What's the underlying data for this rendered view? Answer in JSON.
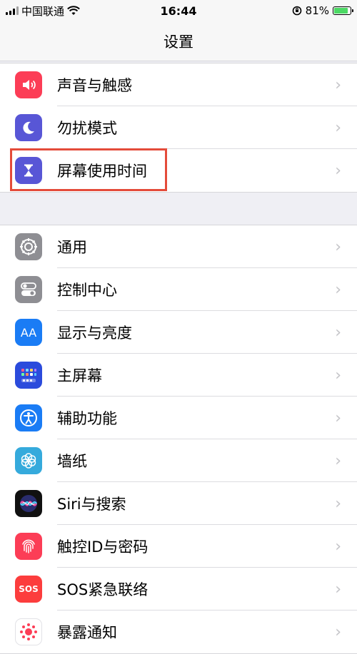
{
  "status_bar": {
    "carrier": "中国联通",
    "time": "16:44",
    "battery_percent": "81%",
    "battery_level": 0.81
  },
  "nav": {
    "title": "设置"
  },
  "group1": [
    {
      "label": "声音与触感",
      "icon": "speaker-icon",
      "color": "#fc3d56"
    },
    {
      "label": "勿扰模式",
      "icon": "moon-icon",
      "color": "#5856d6"
    },
    {
      "label": "屏幕使用时间",
      "icon": "hourglass-icon",
      "color": "#5856d6"
    }
  ],
  "group2": [
    {
      "label": "通用",
      "icon": "gear-icon",
      "color": "#8e8e93"
    },
    {
      "label": "控制中心",
      "icon": "toggles-icon",
      "color": "#8e8e93"
    },
    {
      "label": "显示与亮度",
      "icon": "aa-icon",
      "color": "#1a7cf5",
      "glyph": "AA"
    },
    {
      "label": "主屏幕",
      "icon": "home-grid-icon",
      "color": "#2b4bdc"
    },
    {
      "label": "辅助功能",
      "icon": "accessibility-icon",
      "color": "#1a7cf5"
    },
    {
      "label": "墙纸",
      "icon": "flower-icon",
      "color": "#35aadc"
    },
    {
      "label": "Siri与搜索",
      "icon": "siri-icon",
      "color": "#111111"
    },
    {
      "label": "触控ID与密码",
      "icon": "fingerprint-icon",
      "color": "#fc3d56"
    },
    {
      "label": "SOS紧急联络",
      "icon": "sos-icon",
      "color": "#fc3d3d",
      "glyph": "SOS"
    },
    {
      "label": "暴露通知",
      "icon": "exposure-icon",
      "color": "#ffffff"
    }
  ],
  "chevron": "›"
}
